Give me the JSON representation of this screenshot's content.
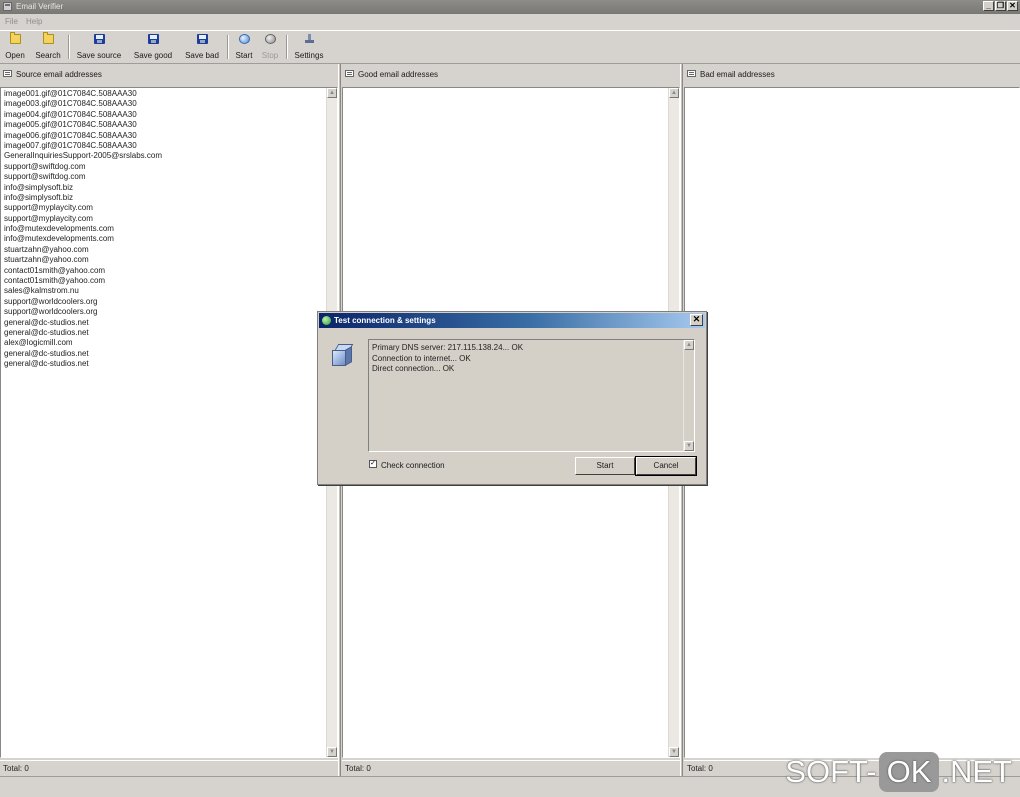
{
  "window": {
    "title": "Email Verifier",
    "controls": [
      "_",
      "❐",
      "✕"
    ]
  },
  "menu": [
    "File",
    "Help"
  ],
  "toolbar": [
    {
      "label": "Open",
      "icon": "folder-open-icon",
      "enabled": true
    },
    {
      "label": "Search",
      "icon": "folder-search-icon",
      "enabled": true
    },
    {
      "label": "Save source",
      "icon": "save-disk-icon",
      "enabled": true
    },
    {
      "label": "Save good",
      "icon": "save-disk-icon",
      "enabled": true
    },
    {
      "label": "Save bad",
      "icon": "save-disk-icon",
      "enabled": true
    },
    {
      "label": "Start",
      "icon": "start-icon",
      "enabled": true
    },
    {
      "label": "Stop",
      "icon": "stop-icon",
      "enabled": false
    },
    {
      "label": "Settings",
      "icon": "settings-icon",
      "enabled": true
    }
  ],
  "panels": {
    "source": {
      "title": "Source email addresses",
      "items": [
        "image001.gif@01C7084C.508AAA30",
        "image003.gif@01C7084C.508AAA30",
        "image004.gif@01C7084C.508AAA30",
        "image005.gif@01C7084C.508AAA30",
        "image006.gif@01C7084C.508AAA30",
        "image007.gif@01C7084C.508AAA30",
        "GeneralInquiriesSupport-2005@srslabs.com",
        "support@swiftdog.com",
        "support@swiftdog.com",
        "info@simplysoft.biz",
        "info@simplysoft.biz",
        "support@myplaycity.com",
        "support@myplaycity.com",
        "info@mutexdevelopments.com",
        "info@mutexdevelopments.com",
        "stuartzahn@yahoo.com",
        "stuartzahn@yahoo.com",
        "contact01smith@yahoo.com",
        "contact01smith@yahoo.com",
        "sales@kalmstrom.nu",
        "support@worldcoolers.org",
        "support@worldcoolers.org",
        "general@dc-studios.net",
        "general@dc-studios.net",
        "alex@logicmill.com",
        "general@dc-studios.net",
        "general@dc-studios.net"
      ],
      "status": "Total: 0"
    },
    "good": {
      "title": "Good email addresses",
      "items": [],
      "status": "Total: 0"
    },
    "bad": {
      "title": "Bad email addresses",
      "items": [],
      "status": "Total: 0"
    }
  },
  "dialog": {
    "title": "Test connection & settings",
    "log": [
      "Primary DNS server: 217.115.138.24... OK",
      "Connection to internet... OK",
      "Direct connection... OK"
    ],
    "check_label": "Check connection",
    "check_checked": true,
    "check_mark": "✓",
    "start_label": "Start",
    "cancel_label": "Cancel",
    "close_glyph": "✕"
  },
  "watermark": {
    "left": "SOFT-",
    "ok": "OK",
    "right": ".NET"
  }
}
